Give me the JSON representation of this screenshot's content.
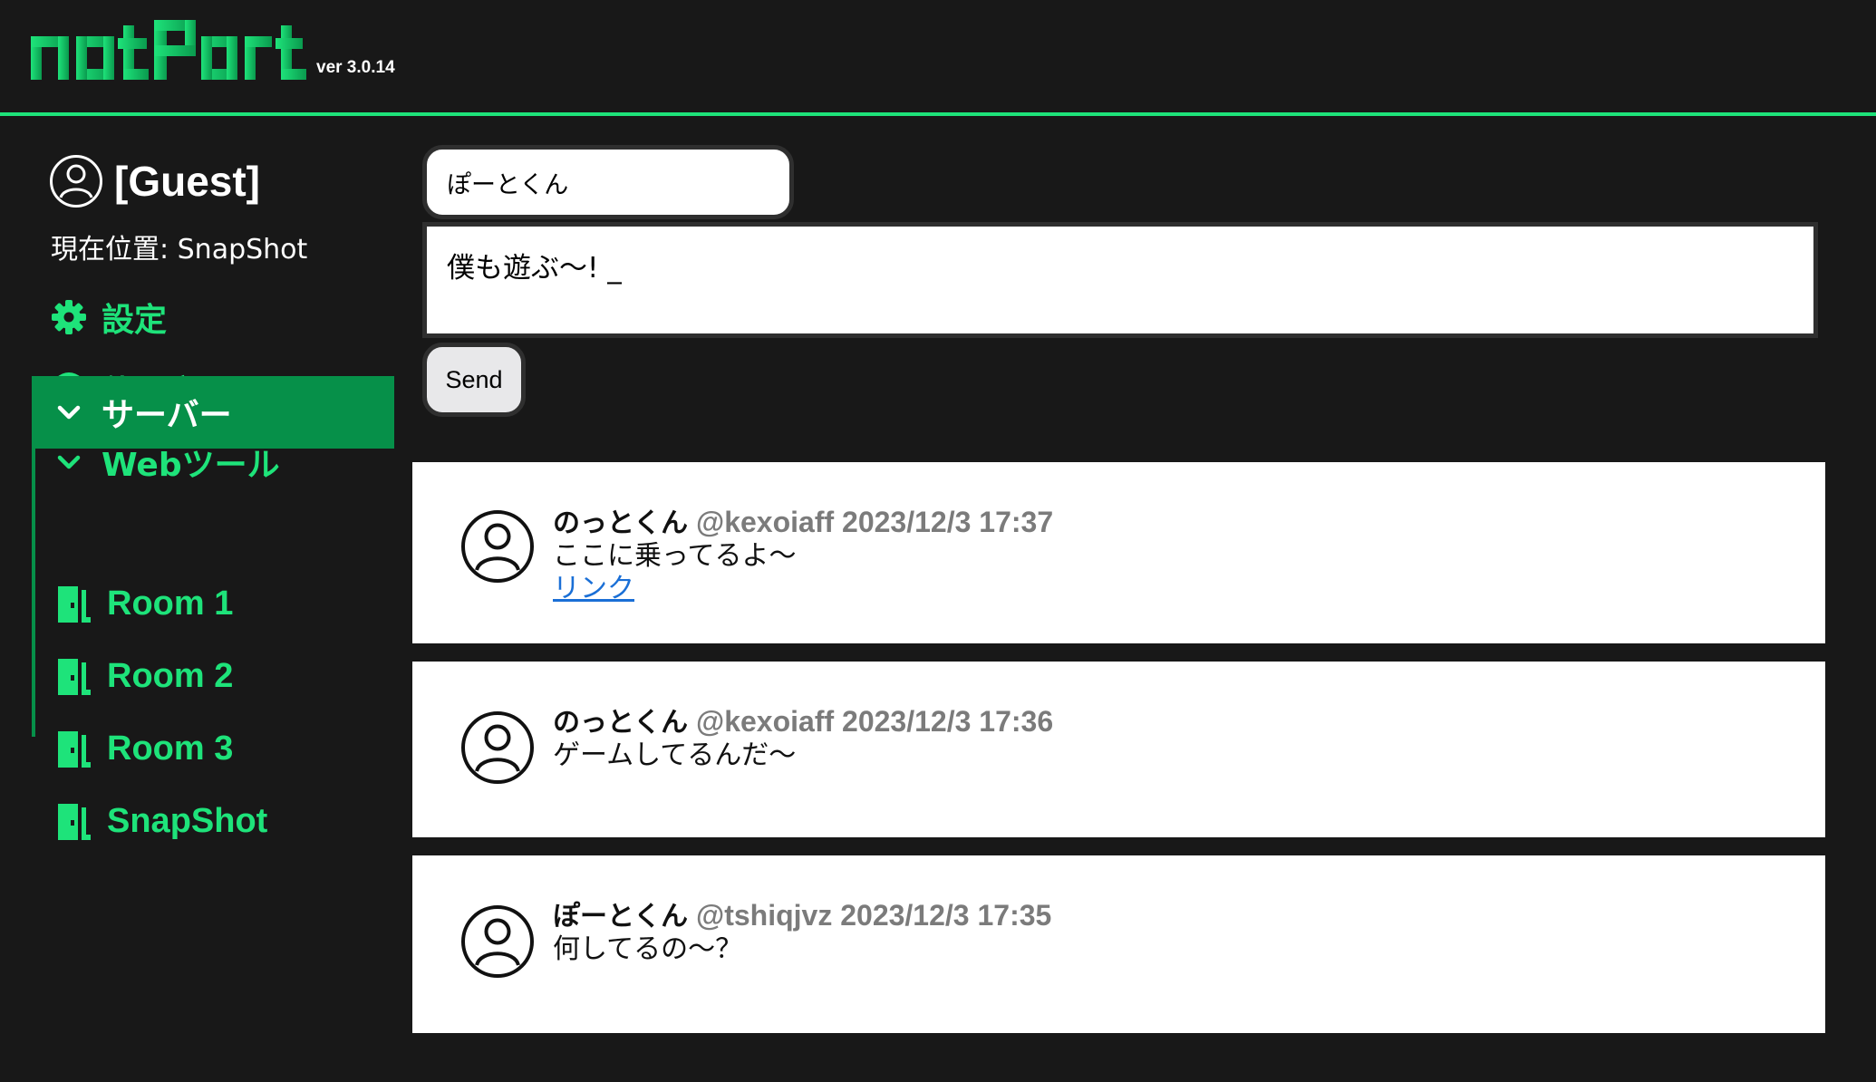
{
  "header": {
    "logo_text": "notPort",
    "version": "ver 3.0.14"
  },
  "sidebar": {
    "user_name": "[Guest]",
    "location": "現在位置: SnapShot",
    "nav": [
      {
        "label": "設定",
        "icon": "gear-icon"
      },
      {
        "label": "使い方",
        "icon": "help-circle-icon"
      },
      {
        "label": "Webツール",
        "icon": "chevron-down-icon"
      },
      {
        "label": "サーバー",
        "icon": "chevron-down-icon",
        "active": true
      }
    ],
    "rooms": [
      {
        "label": "Room 1",
        "icon": "door-icon"
      },
      {
        "label": "Room 2",
        "icon": "door-icon"
      },
      {
        "label": "Room 3",
        "icon": "door-icon"
      },
      {
        "label": "SnapShot",
        "icon": "door-icon"
      }
    ]
  },
  "form": {
    "name_value": "ぽーとくん",
    "message_value": "僕も遊ぶ〜! _",
    "send_label": "Send"
  },
  "posts": [
    {
      "author": "のっとくん",
      "handle": "@kexoiaff",
      "time": "2023/12/3 17:37",
      "body": "ここに乗ってるよ〜",
      "link": "リンク"
    },
    {
      "author": "のっとくん",
      "handle": "@kexoiaff",
      "time": "2023/12/3 17:36",
      "body": "ゲームしてるんだ〜"
    },
    {
      "author": "ぽーとくん",
      "handle": "@tshiqjvz",
      "time": "2023/12/3 17:35",
      "body": "何してるの〜？"
    }
  ],
  "colors": {
    "accent": "#1ee37a",
    "active_bg": "#069049",
    "background": "#181818"
  }
}
